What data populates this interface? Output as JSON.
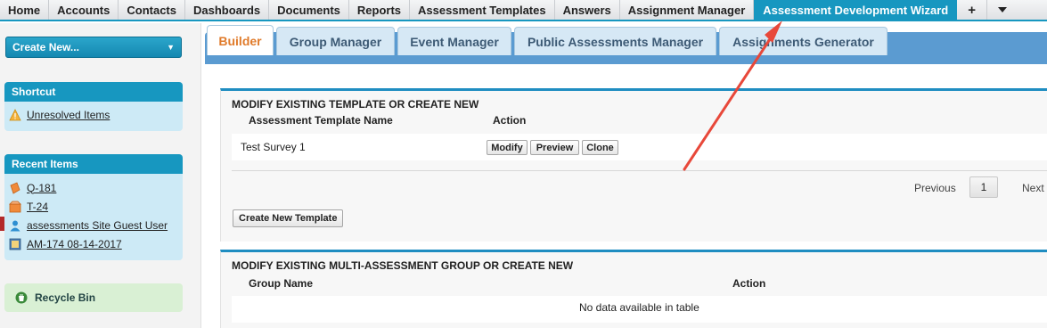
{
  "top_nav": {
    "tabs": [
      {
        "label": "Home"
      },
      {
        "label": "Accounts"
      },
      {
        "label": "Contacts"
      },
      {
        "label": "Dashboards"
      },
      {
        "label": "Documents"
      },
      {
        "label": "Reports"
      },
      {
        "label": "Assessment Templates"
      },
      {
        "label": "Answers"
      },
      {
        "label": "Assignment Manager"
      },
      {
        "label": "Assessment Development Wizard"
      }
    ],
    "plus_label": "+",
    "more_icon": "chevron-down-icon",
    "active_color": "#1797c0"
  },
  "sidebar": {
    "create_new_label": "Create New...",
    "shortcut": {
      "title": "Shortcut",
      "items": [
        {
          "label": "Unresolved Items",
          "icon": "warning-icon"
        }
      ]
    },
    "recent": {
      "title": "Recent Items",
      "items": [
        {
          "label": "Q-181",
          "icon": "question-icon"
        },
        {
          "label": "T-24",
          "icon": "template-icon"
        },
        {
          "label": "assessments Site Guest User",
          "icon": "user-icon"
        },
        {
          "label": "AM-174 08-14-2017",
          "icon": "assignment-icon"
        }
      ]
    },
    "recycle_bin_label": "Recycle Bin"
  },
  "subtabs": [
    {
      "label": "Builder"
    },
    {
      "label": "Group Manager"
    },
    {
      "label": "Event Manager"
    },
    {
      "label": "Public Assessments Manager"
    },
    {
      "label": "Assignments Generator"
    }
  ],
  "templates_section": {
    "title": "MODIFY EXISTING TEMPLATE OR CREATE NEW",
    "columns": [
      "Assessment Template Name",
      "Action"
    ],
    "rows": [
      {
        "name": "Test Survey 1",
        "actions": [
          "Modify",
          "Preview",
          "Clone"
        ]
      }
    ],
    "pager": {
      "previous": "Previous",
      "page": "1",
      "next": "Next"
    },
    "create_button": "Create New Template"
  },
  "groups_section": {
    "title": "MODIFY EXISTING MULTI-ASSESSMENT GROUP OR CREATE NEW",
    "columns": [
      "Group Name",
      "Action"
    ],
    "empty_text": "No data available in table"
  },
  "annotation": {
    "arrow_color": "#e8483a"
  }
}
